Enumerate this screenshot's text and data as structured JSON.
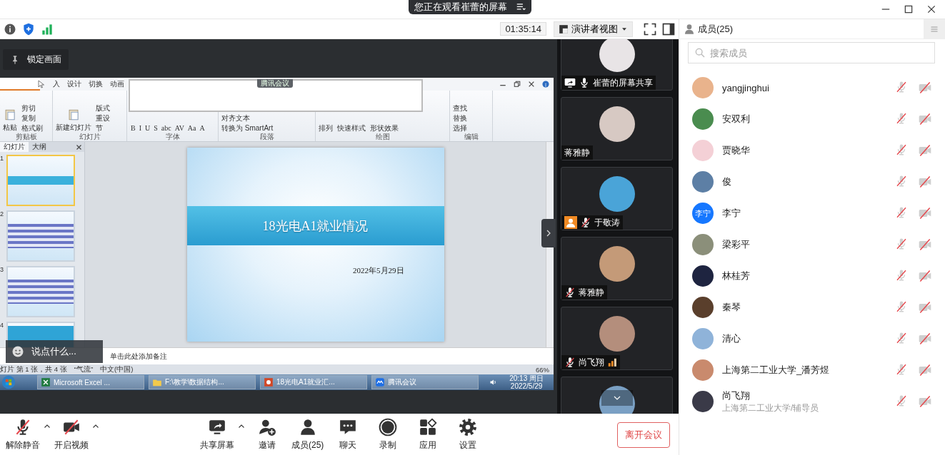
{
  "title_bar": {
    "banner": "您正在观看崔蕾的屏幕"
  },
  "toolbar": {
    "timer": "01:35:14",
    "view_mode": "演讲者视图"
  },
  "shared_screen": {
    "lock_label": "锁定画面",
    "overlay_label": "腾讯会议",
    "chat_placeholder": "说点什么...",
    "ppt": {
      "ribbon_tabs": [
        "入",
        "设计",
        "切换",
        "动画"
      ],
      "ribbon_groups": [
        {
          "kind": "clipboard",
          "label": "剪贴板",
          "large": "粘贴",
          "items": [
            "剪切",
            "复制",
            "格式刷"
          ]
        },
        {
          "kind": "slides",
          "label": "幻灯片",
          "large": "新建幻灯片",
          "items": [
            "版式",
            "重设",
            "节"
          ]
        },
        {
          "kind": "font",
          "label": "字体",
          "items": [
            "B",
            "I",
            "U",
            "S",
            "abc",
            "AV",
            "Aa",
            "A"
          ]
        },
        {
          "kind": "paragraph",
          "label": "段落",
          "items": [
            "对齐文本",
            "转换为 SmartArt"
          ]
        },
        {
          "kind": "drawing",
          "label": "绘图",
          "items": [
            "排列",
            "快速样式",
            "形状效果"
          ]
        },
        {
          "kind": "editing",
          "label": "编辑",
          "items": [
            "查找",
            "替换",
            "选择"
          ]
        }
      ],
      "panel_tabs": [
        {
          "label": "幻灯片",
          "selected": true
        },
        {
          "label": "大纲",
          "selected": false
        }
      ],
      "thumbnails": [
        {
          "number": "1",
          "selected": true
        },
        {
          "number": "2",
          "selected": false
        },
        {
          "number": "3",
          "selected": false
        },
        {
          "number": "4",
          "selected": false
        }
      ],
      "slide": {
        "title": "18光电A1就业情况",
        "date": "2022年5月29日"
      },
      "notes_placeholder": "单击此处添加备注",
      "status_items": [
        "灯片 第 1 张，共 4 张",
        "“气流”",
        "中文(中国)"
      ],
      "zoom": "66%",
      "taskbar_apps": [
        {
          "kind": "excel",
          "label": "Microsoft Excel ..."
        },
        {
          "kind": "folder",
          "label": "F:\\教学\\数据结构..."
        },
        {
          "kind": "ppt",
          "label": "18光电A1就业汇..."
        },
        {
          "kind": "meeting",
          "label": "腾讯会议"
        }
      ],
      "clock_time": "20:13 周日",
      "clock_date": "2022/5/29"
    }
  },
  "video_tiles": [
    {
      "kind": "share",
      "name": "崔蕾的屏幕共享",
      "signal": false
    },
    {
      "kind": "plain",
      "name": "蒋雅静",
      "signal": false
    },
    {
      "kind": "host",
      "name": "于敬涛",
      "signal": false
    },
    {
      "kind": "muted",
      "name": "蒋雅静",
      "signal": false
    },
    {
      "kind": "muted",
      "name": "尚飞翔",
      "signal": true
    },
    {
      "kind": "partial",
      "signal": false
    }
  ],
  "members_panel": {
    "title": "成员(25)",
    "search_placeholder": "搜索成员",
    "members": [
      {
        "name": "yangjinghui",
        "muted": true,
        "video_off": true
      },
      {
        "name": "安双利",
        "muted": true,
        "video_off": true
      },
      {
        "name": "贾晓华",
        "muted": true,
        "video_off": true
      },
      {
        "name": "俊",
        "muted": true,
        "video_off": true
      },
      {
        "name": "李宁",
        "avatar_text": "李宁",
        "muted": true,
        "video_off": true
      },
      {
        "name": "梁彩平",
        "muted": true,
        "video_off": true
      },
      {
        "name": "林桂芳",
        "muted": true,
        "video_off": true
      },
      {
        "name": "秦琴",
        "muted": true,
        "video_off": true
      },
      {
        "name": "清心",
        "muted": true,
        "video_off": true
      },
      {
        "name": "上海第二工业大学_潘芳煜",
        "muted": true,
        "video_off": true
      },
      {
        "name": "尚飞翔",
        "subtitle": "上海第二工业大学/辅导员",
        "muted": true,
        "video_off": true
      }
    ]
  },
  "bottom_bar": {
    "left": [
      {
        "kind": "mic",
        "label": "解除静音",
        "off": true,
        "menu": true
      },
      {
        "kind": "camera",
        "label": "开启视频",
        "off": true,
        "menu": true
      }
    ],
    "center": [
      {
        "kind": "share",
        "label": "共享屏幕",
        "menu": true
      },
      {
        "kind": "invite",
        "label": "邀请",
        "menu": false
      },
      {
        "kind": "members",
        "label": "成员(25)",
        "menu": false
      },
      {
        "kind": "chat",
        "label": "聊天",
        "menu": false
      },
      {
        "kind": "record",
        "label": "录制",
        "menu": false
      },
      {
        "kind": "apps",
        "label": "应用",
        "menu": false
      },
      {
        "kind": "settings",
        "label": "设置",
        "menu": false
      }
    ],
    "leave": "离开会议"
  }
}
